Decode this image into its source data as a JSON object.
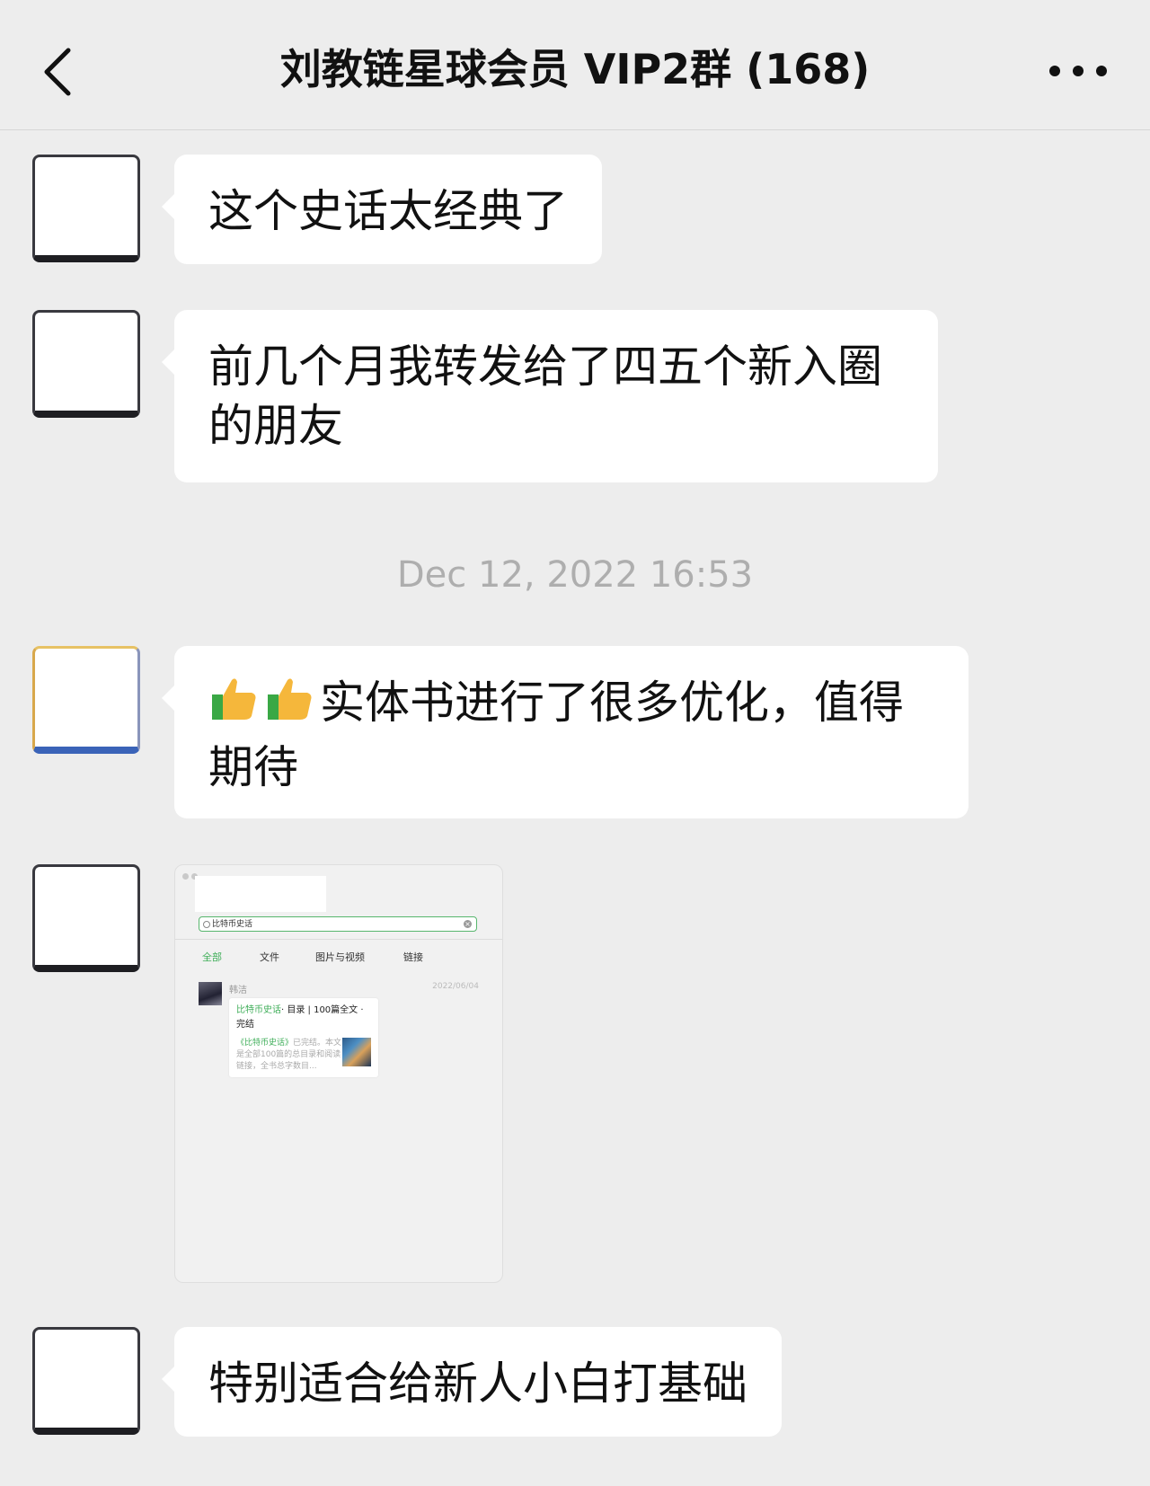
{
  "header": {
    "title": "刘教链星球会员 VIP2群 (168)"
  },
  "messages": [
    {
      "text": "这个史话太经典了"
    },
    {
      "text": "前几个月我转发给了四五个新入圈的朋友"
    },
    {
      "text": "实体书进行了很多优化，值得期待",
      "emoji": "👍👍"
    },
    {
      "text": "特别适合给新人小白打基础"
    }
  ],
  "timestamp": "Dec 12, 2022 16:53",
  "image_message": {
    "search_value": "比特币史话",
    "tabs": [
      "全部",
      "文件",
      "图片与视频",
      "链接"
    ],
    "active_tab": "全部",
    "sender": "韩洁",
    "date": "2022/06/04",
    "card": {
      "title_highlight": "比特币史话",
      "title_rest": "· 目录 | 100篇全文 · 完结",
      "desc_highlight": "《比特币史话》",
      "desc_rest": "已完结。本文是全部100篇的总目录和阅读链接，全书总字数目..."
    }
  },
  "colors": {
    "background": "#ededed",
    "bubble": "#ffffff",
    "accent_green": "#3fae59"
  },
  "icons": {
    "back": "chevron-left-icon",
    "more": "more-dots-icon",
    "thumbs": "thumbs-up-icon"
  }
}
